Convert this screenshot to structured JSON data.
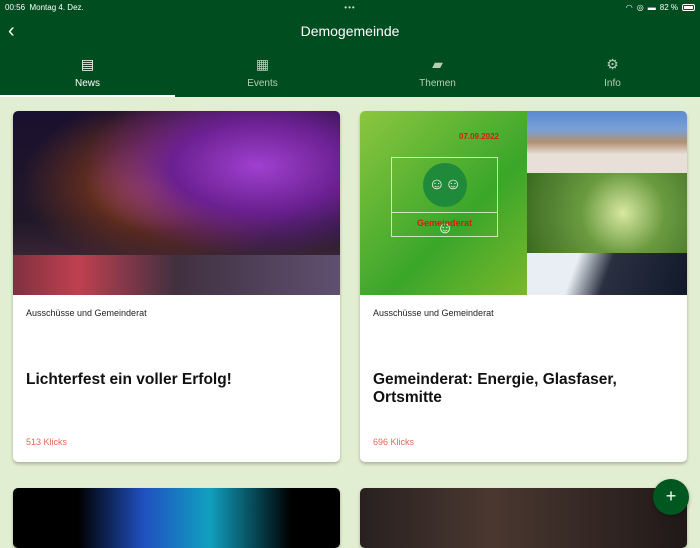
{
  "status": {
    "time": "00:56",
    "date": "Montag 4. Dez.",
    "dots": "•••",
    "battery": "82 %"
  },
  "nav": {
    "title": "Demogemeinde",
    "back_icon": "chevron-left-icon"
  },
  "tabs": [
    {
      "label": "News",
      "icon": "article-icon"
    },
    {
      "label": "Events",
      "icon": "calendar-icon"
    },
    {
      "label": "Themen",
      "icon": "folder-icon"
    },
    {
      "label": "Info",
      "icon": "gear-icon"
    }
  ],
  "cards": [
    {
      "category": "Ausschüsse und Gemeinderat",
      "title": "Lichterfest ein voller Erfolg!",
      "clicks": "513 Klicks"
    },
    {
      "category": "Ausschüsse und Gemeinderat",
      "title": "Gemeinderat: Energie, Glasfaser, Ortsmitte",
      "clicks": "696 Klicks",
      "image_date": "07.09.2022",
      "image_label": "Gemeinderat"
    }
  ],
  "fab": {
    "label": "+"
  },
  "colors": {
    "header": "#004d1f",
    "background": "#e2eed1",
    "clicks": "#e06a5a"
  }
}
